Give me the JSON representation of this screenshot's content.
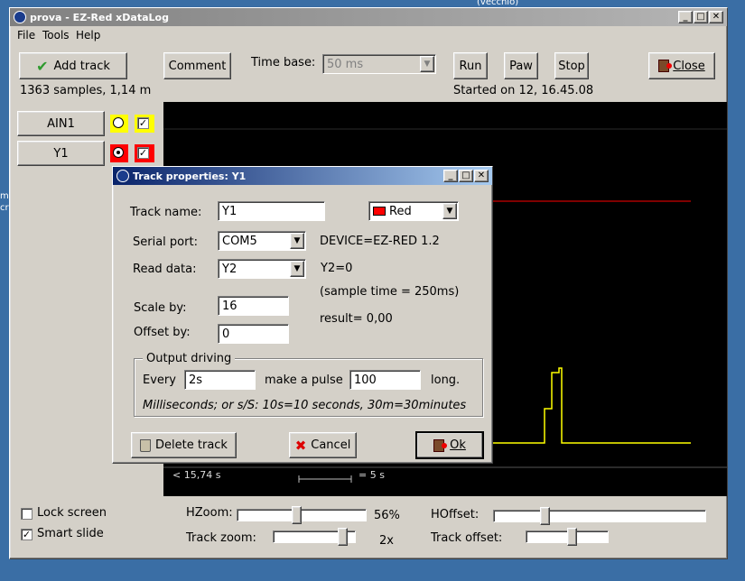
{
  "desktop": {
    "bg_label": "(vecchio)",
    "left_fragments": [
      "m",
      "cri"
    ]
  },
  "main_window": {
    "title": "prova - EZ-Red xDataLog",
    "menu": [
      "File",
      "Tools",
      "Help"
    ],
    "toolbar": {
      "add_track": "Add track",
      "comment": "Comment",
      "time_base_label": "Time base:",
      "time_base_value": "50 ms",
      "run": "Run",
      "paw": "Paw",
      "stop": "Stop",
      "close": "Close"
    },
    "status_left": "1363 samples, 1,14 m",
    "status_right": "Started on 12, 16.45.08",
    "tracks": [
      {
        "name": "AIN1",
        "color": "#ffff00",
        "radio_selected": false,
        "visible": true
      },
      {
        "name": "Y1",
        "color": "#ff0000",
        "radio_selected": true,
        "visible": true
      }
    ],
    "plot": {
      "axis_left": "< 15,74 s",
      "scale_label": "= 5 s"
    },
    "bottom": {
      "lock_screen": "Lock screen",
      "lock_screen_checked": false,
      "smart_slide": "Smart slide",
      "smart_slide_checked": true,
      "hzoom_label": "HZoom:",
      "hzoom_value": "56%",
      "track_zoom_label": "Track zoom:",
      "track_zoom_value": "2x",
      "hoffset_label": "HOffset:",
      "track_offset_label": "Track offset:"
    }
  },
  "dialog": {
    "title": "Track properties: Y1",
    "track_name_label": "Track name:",
    "track_name_value": "Y1",
    "color_value": "Red",
    "serial_port_label": "Serial port:",
    "serial_port_value": "COM5",
    "device_info": "DEVICE=EZ-RED 1.2",
    "read_data_label": "Read data:",
    "read_data_value": "Y2",
    "read_value": "Y2=0",
    "sample_time": "(sample time = 250ms)",
    "scale_label": "Scale by:",
    "scale_value": "16",
    "offset_label": "Offset by:",
    "offset_value": "0",
    "result": "result= 0,00",
    "output_group": "Output driving",
    "every_label": "Every",
    "every_value": "2s",
    "pulse_label": "make a pulse",
    "pulse_value": "100",
    "long_label": "long.",
    "hint": "Milliseconds; or s/S: 10s=10 seconds, 30m=30minutes",
    "delete_button": "Delete track",
    "cancel_button": "Cancel",
    "ok_button": "Ok"
  },
  "colors": {
    "track_red": "#ff0000",
    "track_yellow": "#ffff00",
    "plot_bg": "#000000",
    "dialog_title": "#0a246a"
  }
}
